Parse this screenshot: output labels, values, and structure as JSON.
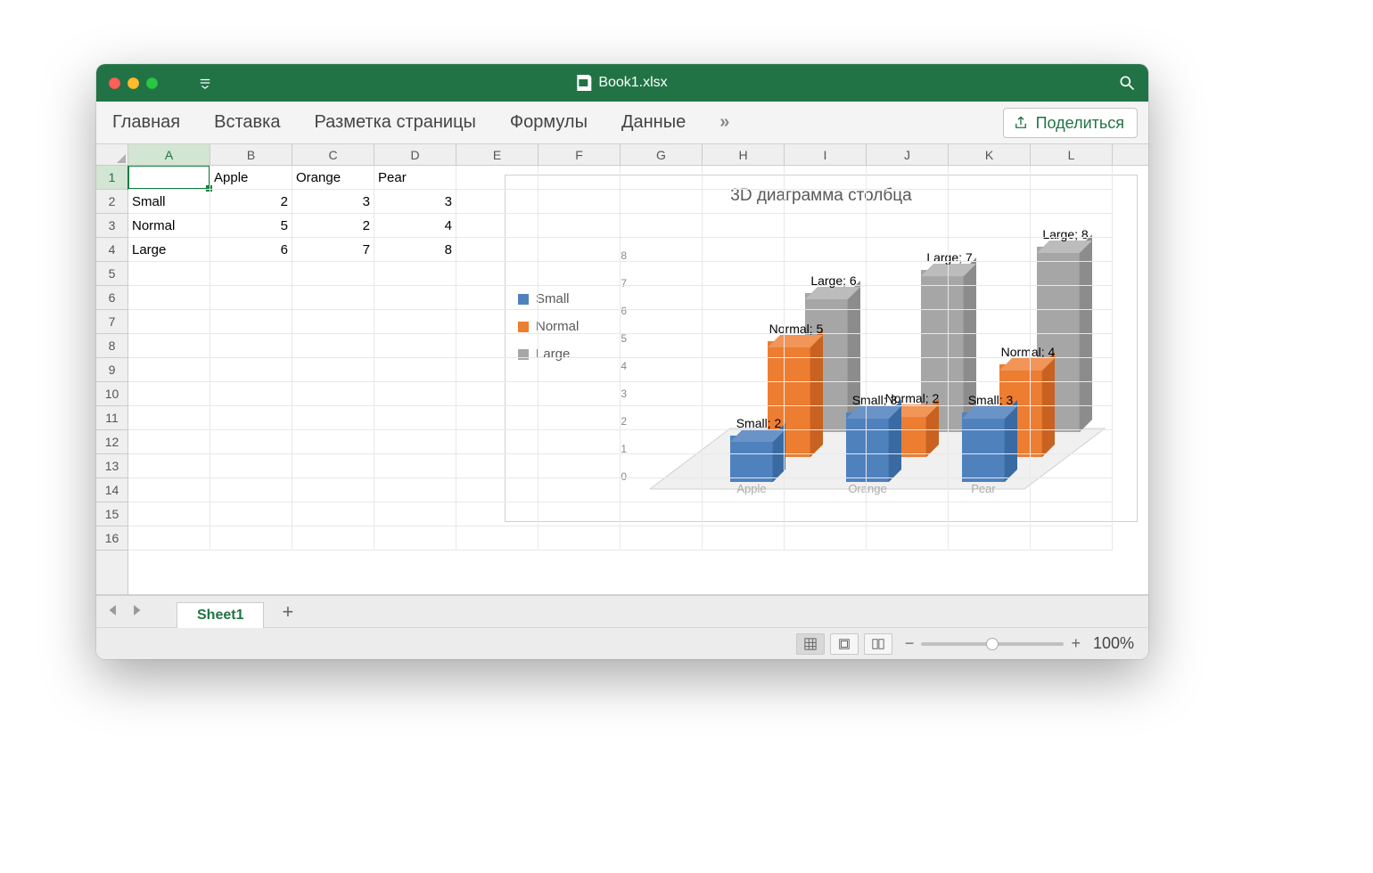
{
  "window": {
    "title": "Book1.xlsx"
  },
  "ribbon": {
    "tabs": [
      "Главная",
      "Вставка",
      "Разметка страницы",
      "Формулы",
      "Данные"
    ],
    "more": "»",
    "share": "Поделиться"
  },
  "columns": [
    "A",
    "B",
    "C",
    "D",
    "E",
    "F",
    "G",
    "H",
    "I",
    "J",
    "K",
    "L"
  ],
  "rows": [
    "1",
    "2",
    "3",
    "4",
    "5",
    "6",
    "7",
    "8",
    "9",
    "10",
    "11",
    "12",
    "13",
    "14",
    "15",
    "16"
  ],
  "selected_cell": "A1",
  "grid": {
    "headers_row": [
      "",
      "Apple",
      "Orange",
      "Pear"
    ],
    "data_rows": [
      {
        "label": "Small",
        "values": [
          2,
          3,
          3
        ]
      },
      {
        "label": "Normal",
        "values": [
          5,
          2,
          4
        ]
      },
      {
        "label": "Large",
        "values": [
          6,
          7,
          8
        ]
      }
    ]
  },
  "chart": {
    "title": "3D диаграмма столбца",
    "legend": [
      {
        "label": "Small",
        "color": "#4f81bd"
      },
      {
        "label": "Normal",
        "color": "#ed7d31"
      },
      {
        "label": "Large",
        "color": "#a6a6a6"
      }
    ],
    "y_ticks": [
      0,
      1,
      2,
      3,
      4,
      5,
      6,
      7,
      8
    ],
    "x_categories": [
      "Apple",
      "Orange",
      "Pear"
    ],
    "data_labels": [
      {
        "text": "Small; 2"
      },
      {
        "text": "Small; 3"
      },
      {
        "text": "Small; 3"
      },
      {
        "text": "Normal; 5"
      },
      {
        "text": "Normal; 2"
      },
      {
        "text": "Normal; 4"
      },
      {
        "text": "Large; 6"
      },
      {
        "text": "Large; 7"
      },
      {
        "text": "Large; 8"
      }
    ]
  },
  "chart_data": {
    "type": "bar",
    "title": "3D диаграмма столбца",
    "categories": [
      "Apple",
      "Orange",
      "Pear"
    ],
    "series": [
      {
        "name": "Small",
        "values": [
          2,
          3,
          3
        ],
        "color": "#4f81bd"
      },
      {
        "name": "Normal",
        "values": [
          5,
          2,
          4
        ],
        "color": "#ed7d31"
      },
      {
        "name": "Large",
        "values": [
          6,
          7,
          8
        ],
        "color": "#a6a6a6"
      }
    ],
    "ylim": [
      0,
      8
    ],
    "xlabel": "",
    "ylabel": ""
  },
  "sheets": {
    "active": "Sheet1"
  },
  "status": {
    "zoom": "100%"
  },
  "colors": {
    "series1": "#4f81bd",
    "series1_dark": "#3a6aa2",
    "series1_light": "#6a93c8",
    "series2": "#ed7d31",
    "series2_dark": "#c96220",
    "series2_light": "#f19559",
    "series3": "#a6a6a6",
    "series3_dark": "#8c8c8c",
    "series3_light": "#bcbcbc"
  }
}
